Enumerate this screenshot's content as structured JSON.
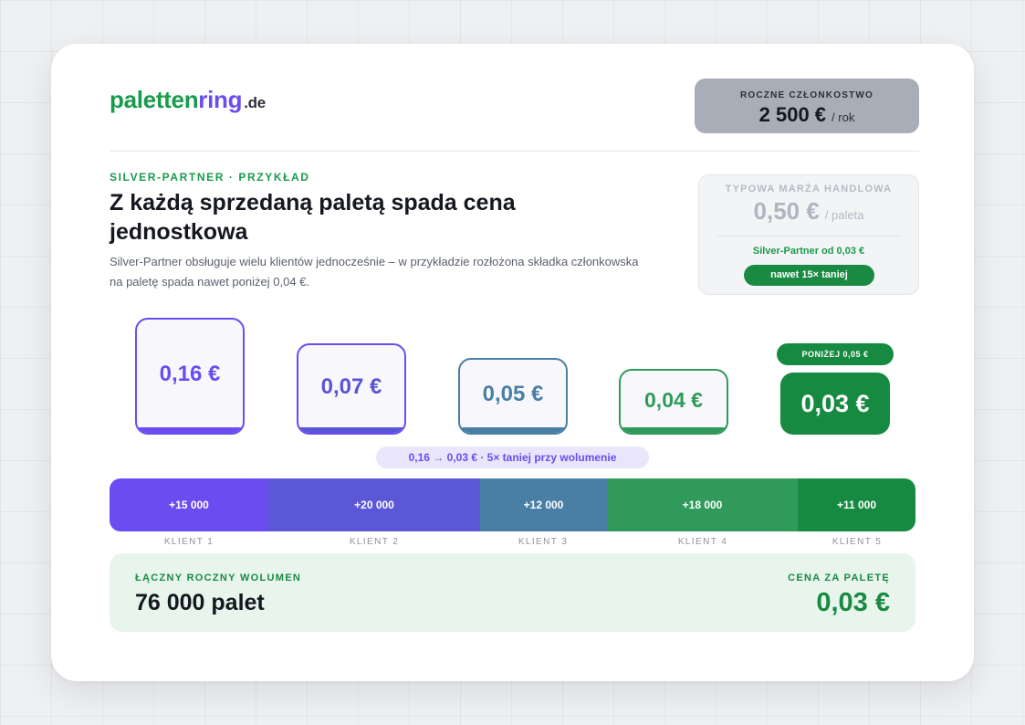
{
  "brand": {
    "part1": "paletten",
    "part2": "ring",
    "tld": ".de"
  },
  "membership": {
    "label": "ROCZNE CZŁONKOSTWO",
    "value": "2 500 €",
    "unit": "/ rok"
  },
  "intro": {
    "eyebrow": "SILVER-PARTNER · PRZYKŁAD",
    "headline": "Z każdą sprzedaną paletą spada cena jednostkowa",
    "subtext": "Silver-Partner obsługuje wielu klientów jednocześnie – w przykładzie rozłożona składka członkowska na paletę spada nawet poniżej 0,04 €."
  },
  "margin_box": {
    "label": "TYPOWA MARŻA HANDLOWA",
    "value": "0,50 €",
    "unit": "/ paleta",
    "partner_text": "Silver-Partner od 0,03 €",
    "pill": "nawet 15× taniej"
  },
  "tiles": [
    {
      "value": "0,16 €",
      "color": "#6a4cf0"
    },
    {
      "value": "0,07 €",
      "color": "#5a54d6"
    },
    {
      "value": "0,05 €",
      "color": "#4a7fa5"
    },
    {
      "value": "0,04 €",
      "color": "#2f9a5a"
    },
    {
      "value": "0,03 €",
      "color": "#168a40",
      "badge": "PONIŻEJ 0,05 €"
    }
  ],
  "comparison": "0,16 → 0,03 € · 5× taniej przy wolumenie",
  "volume_segments": [
    {
      "label": "+15 000",
      "value": 15000,
      "client": "KLIENT 1",
      "color": "#6a4cf0"
    },
    {
      "label": "+20 000",
      "value": 20000,
      "client": "KLIENT 2",
      "color": "#5b57d6"
    },
    {
      "label": "+12 000",
      "value": 12000,
      "client": "KLIENT 3",
      "color": "#4a7fa5"
    },
    {
      "label": "+18 000",
      "value": 18000,
      "client": "KLIENT 4",
      "color": "#2f9a5a"
    },
    {
      "label": "+11 000",
      "value": 11000,
      "client": "KLIENT 5",
      "color": "#168a40"
    }
  ],
  "summary": {
    "volume_label": "ŁĄCZNY ROCZNY WOLUMEN",
    "volume_value": "76 000 palet",
    "price_label": "CENA ZA PALETĘ",
    "price_value": "0,03 €"
  }
}
